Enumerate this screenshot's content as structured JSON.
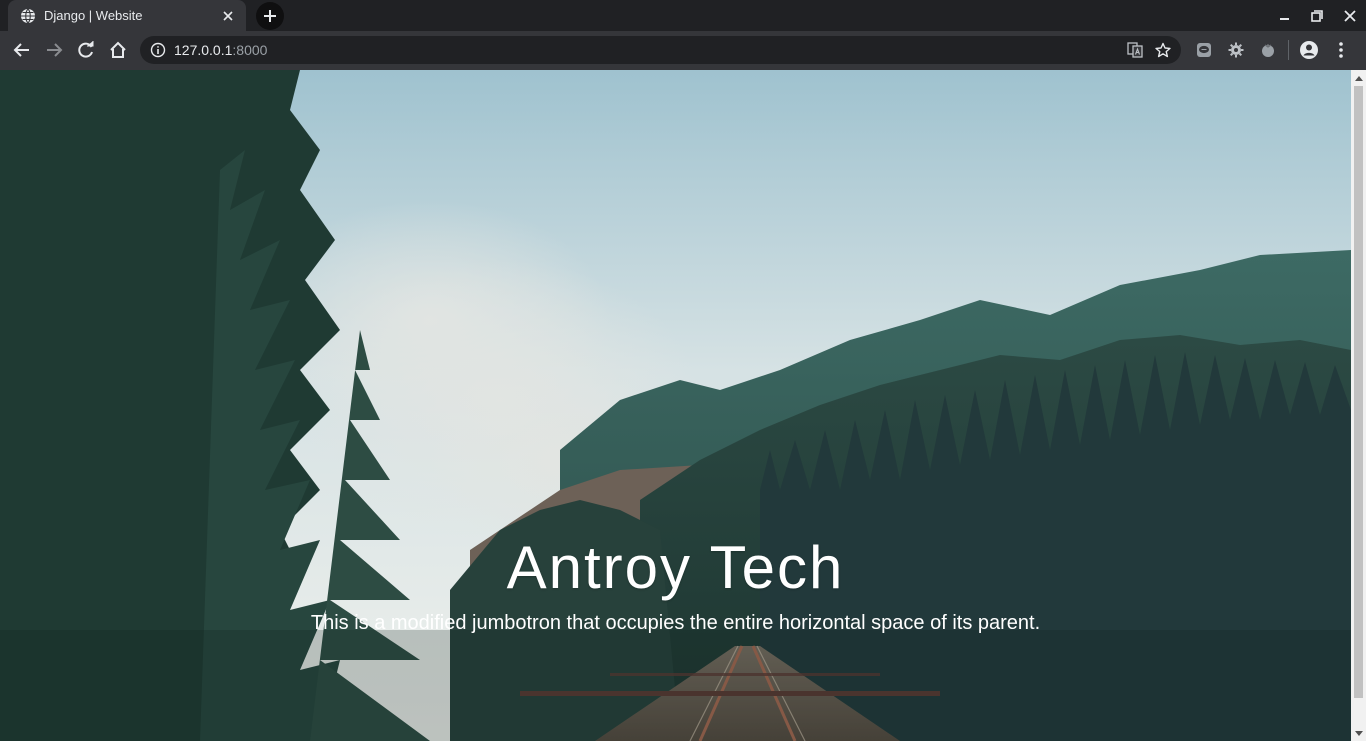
{
  "browser": {
    "tab": {
      "title": "Django | Website",
      "favicon": "globe-icon"
    },
    "new_tab_icon": "plus-icon",
    "window_controls": [
      "minimize-icon",
      "restore-icon",
      "close-icon"
    ],
    "address": {
      "host": "127.0.0.1",
      "port": ":8000"
    },
    "colors": {
      "chrome": "#35363a",
      "tabstrip": "#202124",
      "text": "#e8eaed"
    }
  },
  "page": {
    "title": "Antroy Tech",
    "lead": "This is a modified jumbotron that occupies the entire horizontal space of its parent."
  }
}
